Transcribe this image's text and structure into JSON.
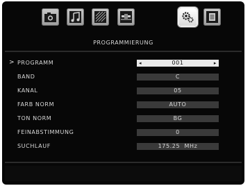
{
  "menu": {
    "title": "PROGRAMMIERUNG",
    "tabs": [
      {
        "name": "picture-settings",
        "icon": "camera-icon",
        "active": false
      },
      {
        "name": "sound-settings",
        "icon": "music-note-icon",
        "active": false
      },
      {
        "name": "feature-settings",
        "icon": "stripes-icon",
        "active": false
      },
      {
        "name": "connection-settings",
        "icon": "cable-icon",
        "active": false
      },
      {
        "name": "setup-settings",
        "icon": "gear-icon",
        "active": true
      },
      {
        "name": "info-settings",
        "icon": "document-icon",
        "active": false
      }
    ],
    "cursor": ">",
    "items": [
      {
        "label": "PROGRAMM",
        "value": "001",
        "selected": true
      },
      {
        "label": "BAND",
        "value": "C",
        "selected": false
      },
      {
        "label": "KANAL",
        "value": "05",
        "selected": false
      },
      {
        "label": "FARB NORM",
        "value": "AUTO",
        "selected": false
      },
      {
        "label": "TON NORM",
        "value": "BG",
        "selected": false
      },
      {
        "label": "FEINABSTIMMUNG",
        "value": "0",
        "selected": false
      },
      {
        "label": "SUCHLAUF",
        "value": "175.25  MHz",
        "selected": false
      }
    ],
    "arrows": {
      "left": "◂",
      "right": "▸"
    }
  }
}
